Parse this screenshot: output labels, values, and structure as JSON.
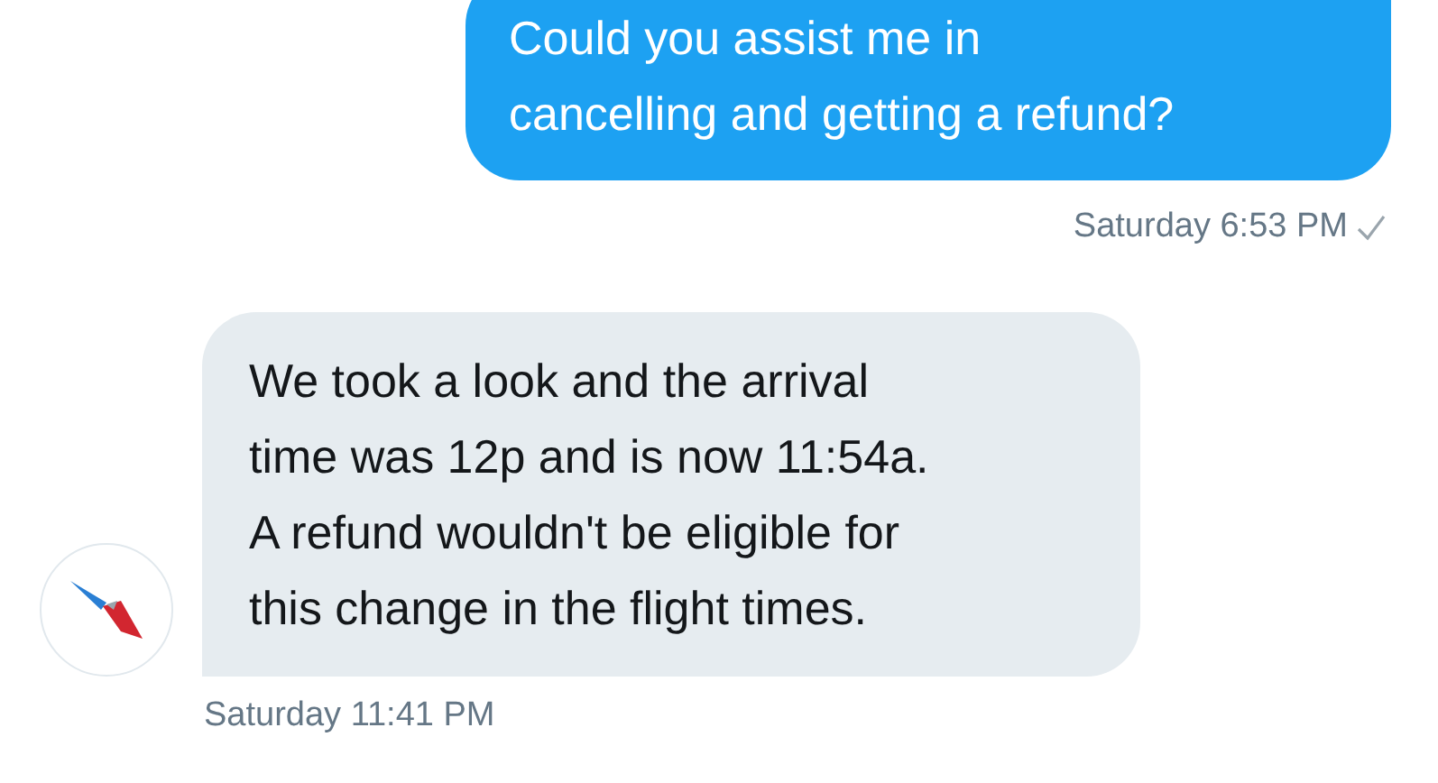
{
  "messages": [
    {
      "kind": "sent",
      "lines": [
        "Could you assist me in",
        "cancelling and getting a refund?"
      ],
      "time": "Saturday 6:53 PM",
      "read": true
    },
    {
      "kind": "received",
      "lines": [
        "We took a look and the arrival",
        "time was 12p and is now 11:54a.",
        "A refund wouldn't be eligible for",
        "this change in the flight times."
      ],
      "time": "Saturday 11:41 PM"
    }
  ]
}
